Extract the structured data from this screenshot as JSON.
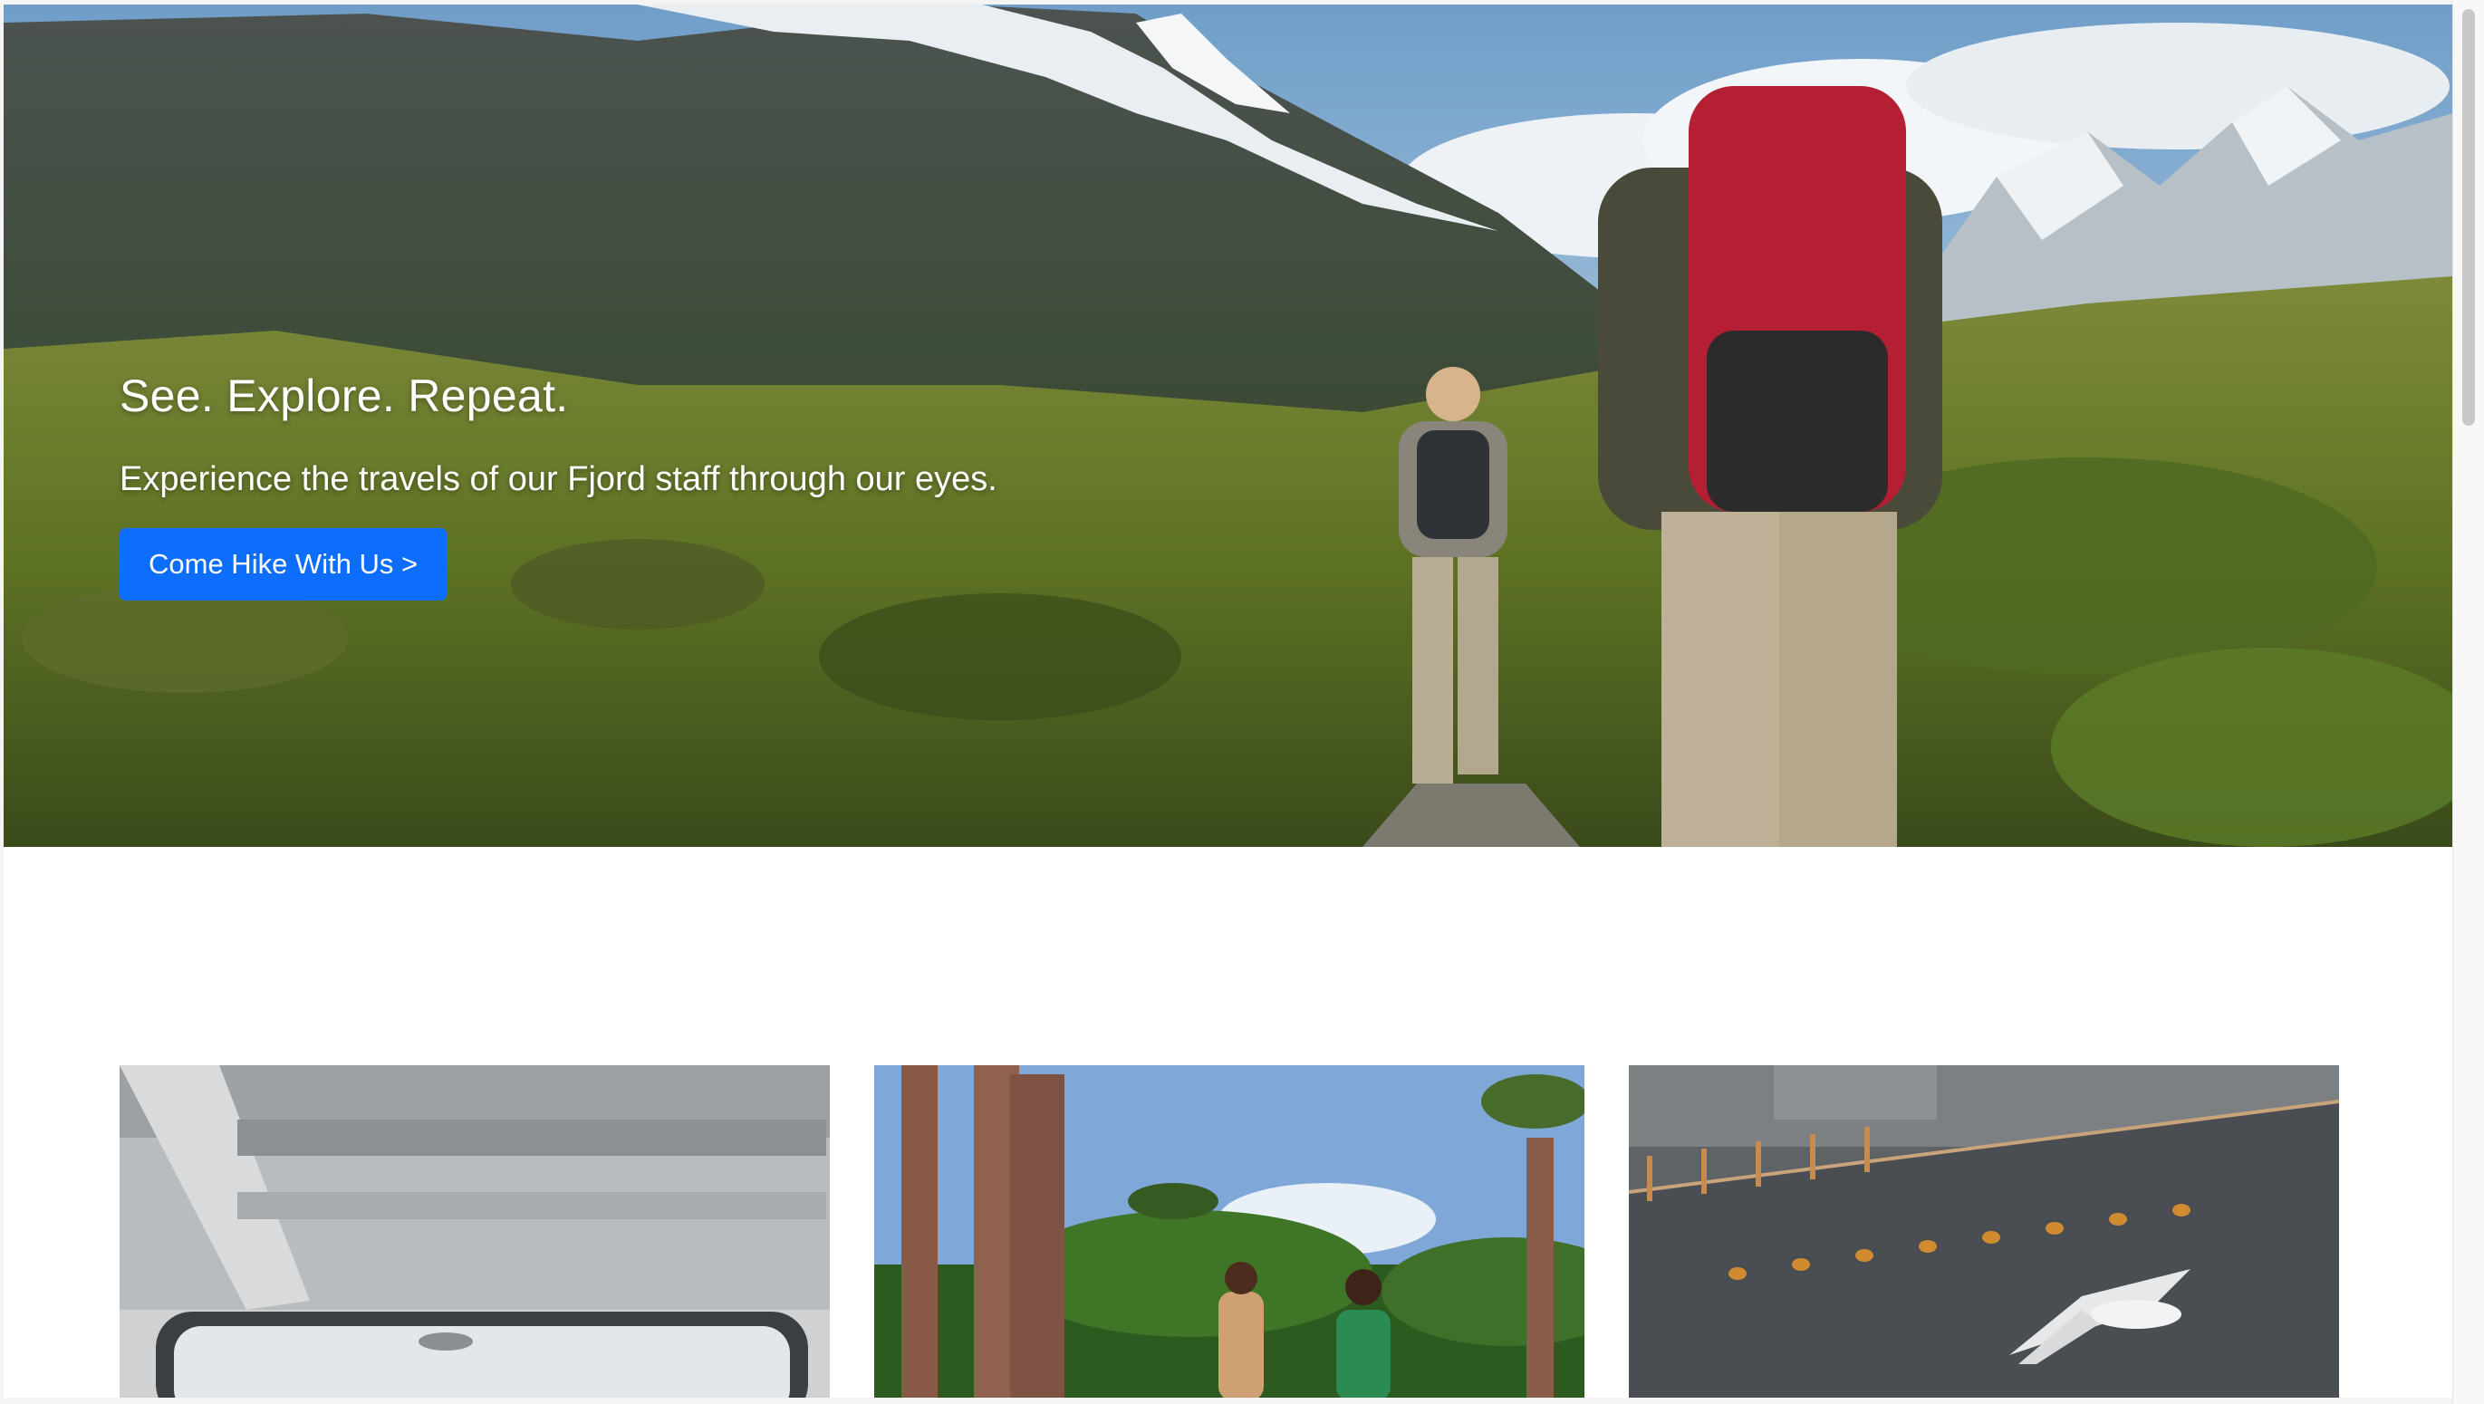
{
  "hero": {
    "title": "See. Explore. Repeat.",
    "subtitle": "Experience the travels of our Fjord staff through our eyes.",
    "button_label": "Come Hike With Us >",
    "image": "mountain-hikers-photo"
  },
  "cards": [
    {
      "image": "ferry-window-photo"
    },
    {
      "image": "baobab-avenue-photo"
    },
    {
      "image": "ship-and-seagull-photo"
    }
  ],
  "colors": {
    "button": "#0d6efd",
    "hero_text": "#ffffff",
    "background": "#ffffff"
  }
}
